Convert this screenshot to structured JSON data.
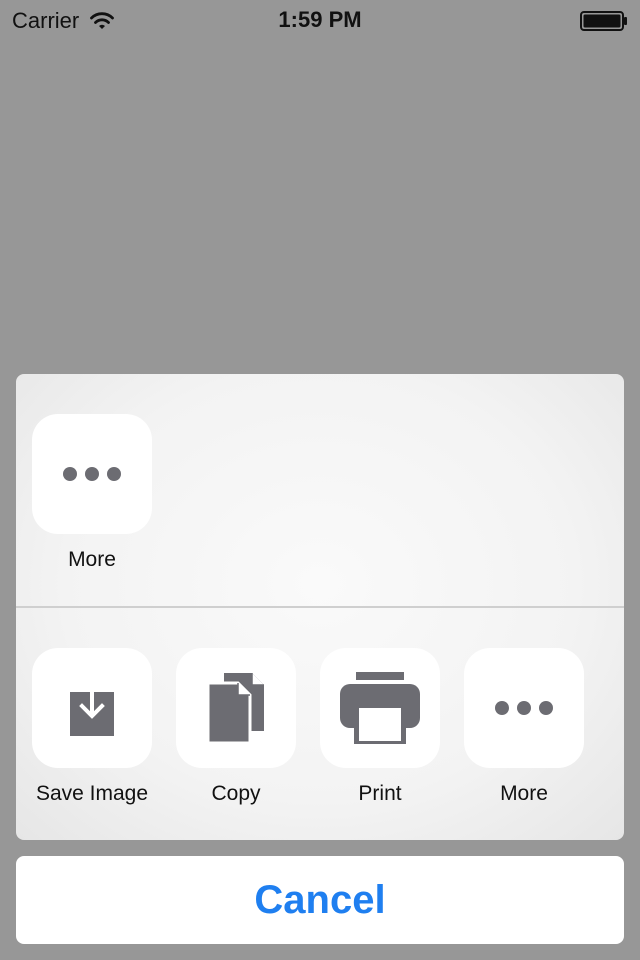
{
  "status_bar": {
    "carrier": "Carrier",
    "time": "1:59 PM"
  },
  "share_sheet": {
    "top_row": [
      {
        "label": "More",
        "icon": "more-dots-icon"
      }
    ],
    "bottom_row": [
      {
        "label": "Save Image",
        "icon": "save-image-icon"
      },
      {
        "label": "Copy",
        "icon": "copy-icon"
      },
      {
        "label": "Print",
        "icon": "print-icon"
      },
      {
        "label": "More",
        "icon": "more-dots-icon"
      }
    ]
  },
  "cancel_label": "Cancel",
  "colors": {
    "backdrop": "#979797",
    "accent": "#1f7ff0",
    "icon": "#6c6c72"
  }
}
